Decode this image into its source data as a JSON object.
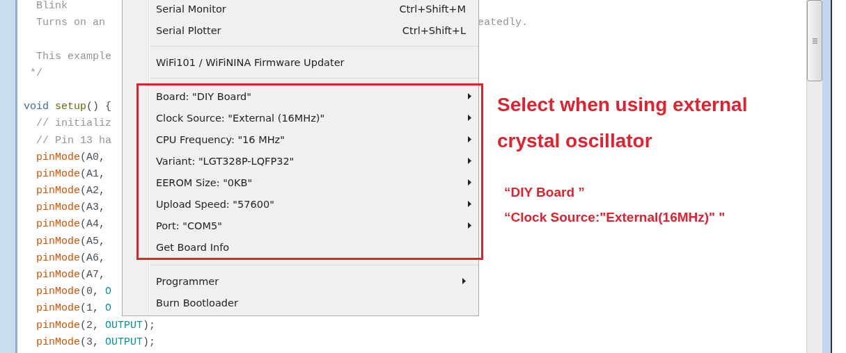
{
  "editor": {
    "code_lines": [
      {
        "kind": "code",
        "tokens": [
          {
            "kind": "comment",
            "text": "  Blink"
          }
        ]
      },
      {
        "kind": "code",
        "tokens": [
          {
            "kind": "comment",
            "text": "  Turns on an"
          }
        ],
        "tail": "eatedly."
      },
      {
        "kind": "blank"
      },
      {
        "kind": "code",
        "tokens": [
          {
            "kind": "comment",
            "text": "  This example"
          }
        ]
      },
      {
        "kind": "code",
        "tokens": [
          {
            "kind": "comment",
            "text": " */"
          }
        ]
      },
      {
        "kind": "blank"
      },
      {
        "kind": "code",
        "tokens": [
          {
            "kind": "keyword",
            "text": "void"
          },
          {
            "kind": "function",
            "text": " setup"
          },
          {
            "kind": "plain",
            "text": "() {"
          }
        ]
      },
      {
        "kind": "code",
        "tokens": [
          {
            "kind": "comment",
            "text": "  // initializ"
          }
        ]
      },
      {
        "kind": "code",
        "tokens": [
          {
            "kind": "comment",
            "text": "  // Pin 13 ha"
          }
        ]
      },
      {
        "kind": "code",
        "tokens": [
          {
            "kind": "call",
            "text": "  pinMode"
          },
          {
            "kind": "plain",
            "text": "(A0,"
          }
        ]
      },
      {
        "kind": "code",
        "tokens": [
          {
            "kind": "call",
            "text": "  pinMode"
          },
          {
            "kind": "plain",
            "text": "(A1,"
          }
        ]
      },
      {
        "kind": "code",
        "tokens": [
          {
            "kind": "call",
            "text": "  pinMode"
          },
          {
            "kind": "plain",
            "text": "(A2,"
          }
        ]
      },
      {
        "kind": "code",
        "tokens": [
          {
            "kind": "call",
            "text": "  pinMode"
          },
          {
            "kind": "plain",
            "text": "(A3,"
          }
        ]
      },
      {
        "kind": "code",
        "tokens": [
          {
            "kind": "call",
            "text": "  pinMode"
          },
          {
            "kind": "plain",
            "text": "(A4,"
          }
        ]
      },
      {
        "kind": "code",
        "tokens": [
          {
            "kind": "call",
            "text": "  pinMode"
          },
          {
            "kind": "plain",
            "text": "(A5,"
          }
        ]
      },
      {
        "kind": "code",
        "tokens": [
          {
            "kind": "call",
            "text": "  pinMode"
          },
          {
            "kind": "plain",
            "text": "(A6,"
          }
        ]
      },
      {
        "kind": "code",
        "tokens": [
          {
            "kind": "call",
            "text": "  pinMode"
          },
          {
            "kind": "plain",
            "text": "(A7,"
          }
        ]
      },
      {
        "kind": "code",
        "tokens": [
          {
            "kind": "call",
            "text": "  pinMode"
          },
          {
            "kind": "plain",
            "text": "(0, "
          },
          {
            "kind": "constant",
            "text": "O"
          }
        ]
      },
      {
        "kind": "code",
        "tokens": [
          {
            "kind": "call",
            "text": "  pinMode"
          },
          {
            "kind": "plain",
            "text": "(1, "
          },
          {
            "kind": "constant",
            "text": "O"
          }
        ]
      },
      {
        "kind": "code",
        "tokens": [
          {
            "kind": "call",
            "text": "  pinMode"
          },
          {
            "kind": "plain",
            "text": "(2, "
          },
          {
            "kind": "constant",
            "text": "OUTPUT"
          },
          {
            "kind": "plain",
            "text": ");"
          }
        ]
      },
      {
        "kind": "code",
        "tokens": [
          {
            "kind": "call",
            "text": "  pinMode"
          },
          {
            "kind": "plain",
            "text": "(3, "
          },
          {
            "kind": "constant",
            "text": "OUTPUT"
          },
          {
            "kind": "plain",
            "text": ");"
          }
        ]
      }
    ]
  },
  "menu": {
    "items": [
      {
        "kind": "item",
        "label": "Serial Monitor",
        "shortcut": "Ctrl+Shift+M",
        "submenu": false
      },
      {
        "kind": "item",
        "label": "Serial Plotter",
        "shortcut": "Ctrl+Shift+L",
        "submenu": false
      },
      {
        "kind": "separator"
      },
      {
        "kind": "item",
        "label": "WiFi101 / WiFiNINA Firmware Updater",
        "submenu": false
      },
      {
        "kind": "separator"
      },
      {
        "kind": "item",
        "label": "Board: \"DIY Board\"",
        "submenu": true,
        "highlighted": true
      },
      {
        "kind": "item",
        "label": "Clock Source: \"External (16MHz)\"",
        "submenu": true,
        "highlighted": true
      },
      {
        "kind": "item",
        "label": "CPU Frequency: \"16 MHz\"",
        "submenu": true,
        "highlighted": true
      },
      {
        "kind": "item",
        "label": "Variant: \"LGT328P-LQFP32\"",
        "submenu": true,
        "highlighted": true
      },
      {
        "kind": "item",
        "label": "EEROM Size: \"0KB\"",
        "submenu": true,
        "highlighted": true
      },
      {
        "kind": "item",
        "label": "Upload Speed: \"57600\"",
        "submenu": true,
        "highlighted": true
      },
      {
        "kind": "item",
        "label": "Port: \"COM5\"",
        "submenu": true,
        "highlighted": true
      },
      {
        "kind": "item",
        "label": "Get Board Info",
        "submenu": false,
        "highlighted": true
      },
      {
        "kind": "separator"
      },
      {
        "kind": "item",
        "label": "Programmer",
        "submenu": true
      },
      {
        "kind": "item",
        "label": "Burn Bootloader",
        "submenu": false
      }
    ]
  },
  "annotation": {
    "title_lines": [
      "Select when using external",
      "crystal oscillator"
    ],
    "values": [
      "“DIY Board ”",
      "“Clock Source:\"External(16MHz)\" \""
    ]
  }
}
